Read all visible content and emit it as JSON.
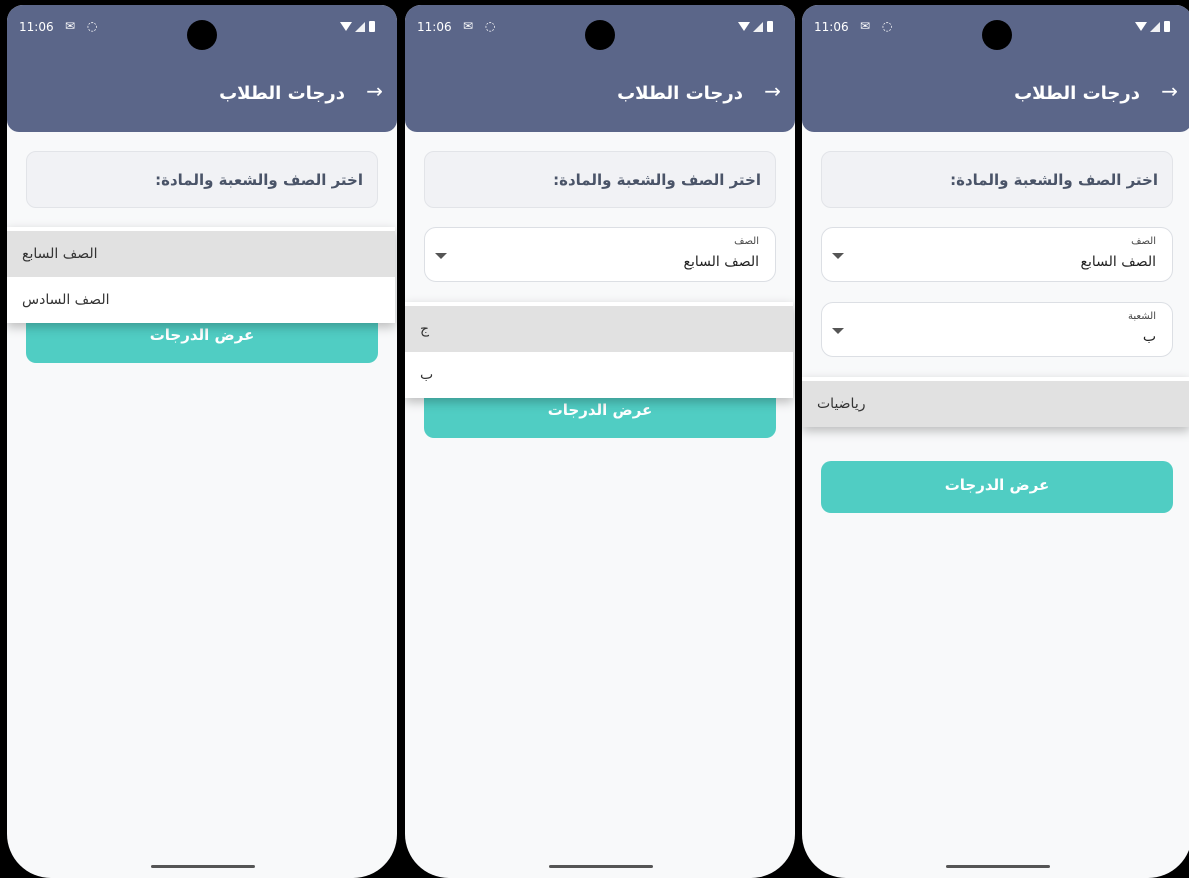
{
  "status_bar": {
    "time": "11:06"
  },
  "app_bar": {
    "title": "درجات الطلاب",
    "back_arrow": "→"
  },
  "instruction": "اختر الصف والشعبة والمادة:",
  "fields": {
    "grade_label": "الصف",
    "grade_value": "الصف السابع",
    "section_label": "الشعبة",
    "section_value": "ب"
  },
  "show_grades_button": "عرض الدرجات",
  "screens": [
    {
      "menu": {
        "items": [
          "الصف السابع",
          "الصف السادس"
        ],
        "selected": 0
      }
    },
    {
      "menu": {
        "items": [
          "ج",
          "ب"
        ],
        "selected": 0
      }
    },
    {
      "menu": {
        "items": [
          "رياضيات"
        ],
        "selected": 0
      }
    }
  ],
  "icons": {
    "back": "arrow-right-icon",
    "dropdown": "caret-down-icon",
    "camera": "camera-cutout-icon"
  },
  "colors": {
    "app_bar": "#5b6689",
    "accent_button": "#50cdc3",
    "background": "#f8f9fa",
    "menu_selected": "#e1e1e1"
  }
}
